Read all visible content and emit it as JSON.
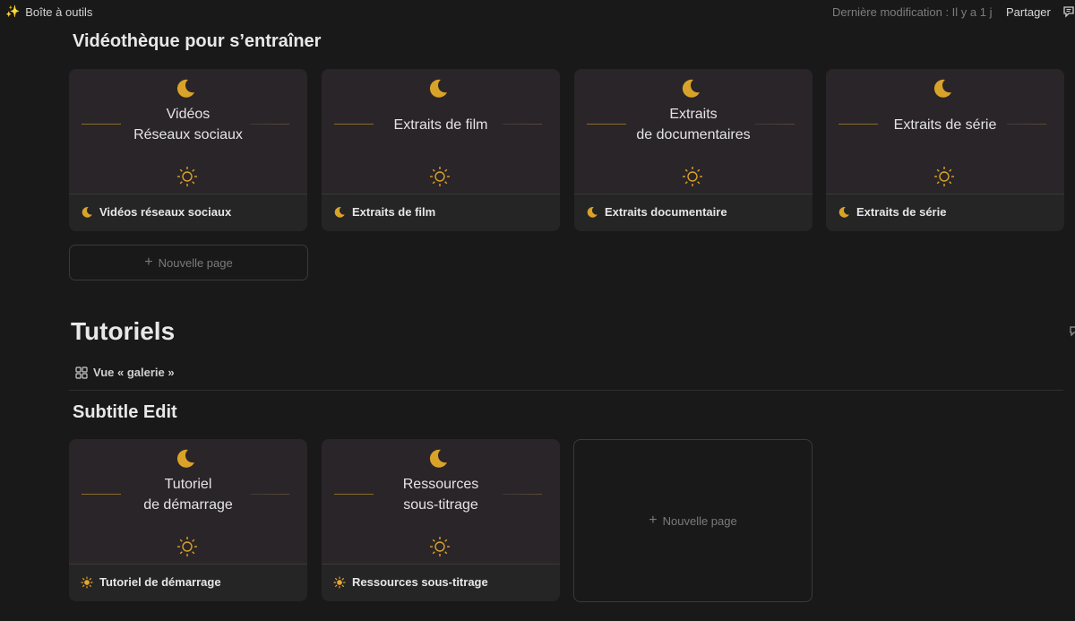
{
  "topbar": {
    "breadcrumb": "Boîte à outils",
    "last_modified": "Dernière modification : Il y a 1 j",
    "share": "Partager"
  },
  "section1": {
    "heading": "Vidéothèque pour s’entraîner",
    "cards": [
      {
        "cover_title": "Vidéos\nRéseaux sociaux",
        "label": "Vidéos réseaux sociaux",
        "icon": "moon-icon"
      },
      {
        "cover_title": "Extraits de film",
        "label": "Extraits de film",
        "icon": "moon-icon"
      },
      {
        "cover_title": "Extraits\nde documentaires",
        "label": "Extraits documentaire",
        "icon": "moon-icon"
      },
      {
        "cover_title": "Extraits de série",
        "label": "Extraits de série",
        "icon": "moon-icon"
      }
    ],
    "new_page": "Nouvelle page"
  },
  "tutoriels": {
    "heading": "Tutoriels",
    "view_label": "Vue « galerie »"
  },
  "section2": {
    "heading": "Subtitle Edit",
    "cards": [
      {
        "cover_title": "Tutoriel\nde démarrage",
        "label": "Tutoriel de démarrage",
        "icon": "sun-icon"
      },
      {
        "cover_title": "Ressources\nsous-titrage",
        "label": "Ressources sous-titrage",
        "icon": "sun-icon"
      }
    ],
    "new_page": "Nouvelle page"
  },
  "colors": {
    "background": "#191919",
    "card": "#252525",
    "cover": "#2a2528",
    "accent_gold": "#d9a32a"
  }
}
